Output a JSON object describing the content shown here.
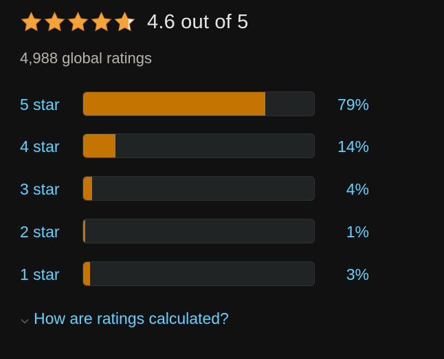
{
  "summary": {
    "rating_value": 4.6,
    "rating_text": "4.6 out of 5",
    "global_ratings": "4,988 global ratings",
    "stars": [
      "star-full-icon",
      "star-full-icon",
      "star-full-icon",
      "star-full-icon",
      "star-half-icon"
    ]
  },
  "histogram": [
    {
      "label": "5 star",
      "percent_text": "79%",
      "percent": 79
    },
    {
      "label": "4 star",
      "percent_text": "14%",
      "percent": 14
    },
    {
      "label": "3 star",
      "percent_text": "4%",
      "percent": 4
    },
    {
      "label": "2 star",
      "percent_text": "1%",
      "percent": 1
    },
    {
      "label": "1 star",
      "percent_text": "3%",
      "percent": 3
    }
  ],
  "footer": {
    "link_text": "How are ratings calculated?",
    "icon": "chevron-down-icon"
  },
  "colors": {
    "background": "#111111",
    "star": "#f3a33a",
    "bar_fill": "#c47400",
    "bar_track": "#202425",
    "link": "#63d1ff",
    "text": "#e6e6e6",
    "muted_text": "#b9b3aa"
  }
}
